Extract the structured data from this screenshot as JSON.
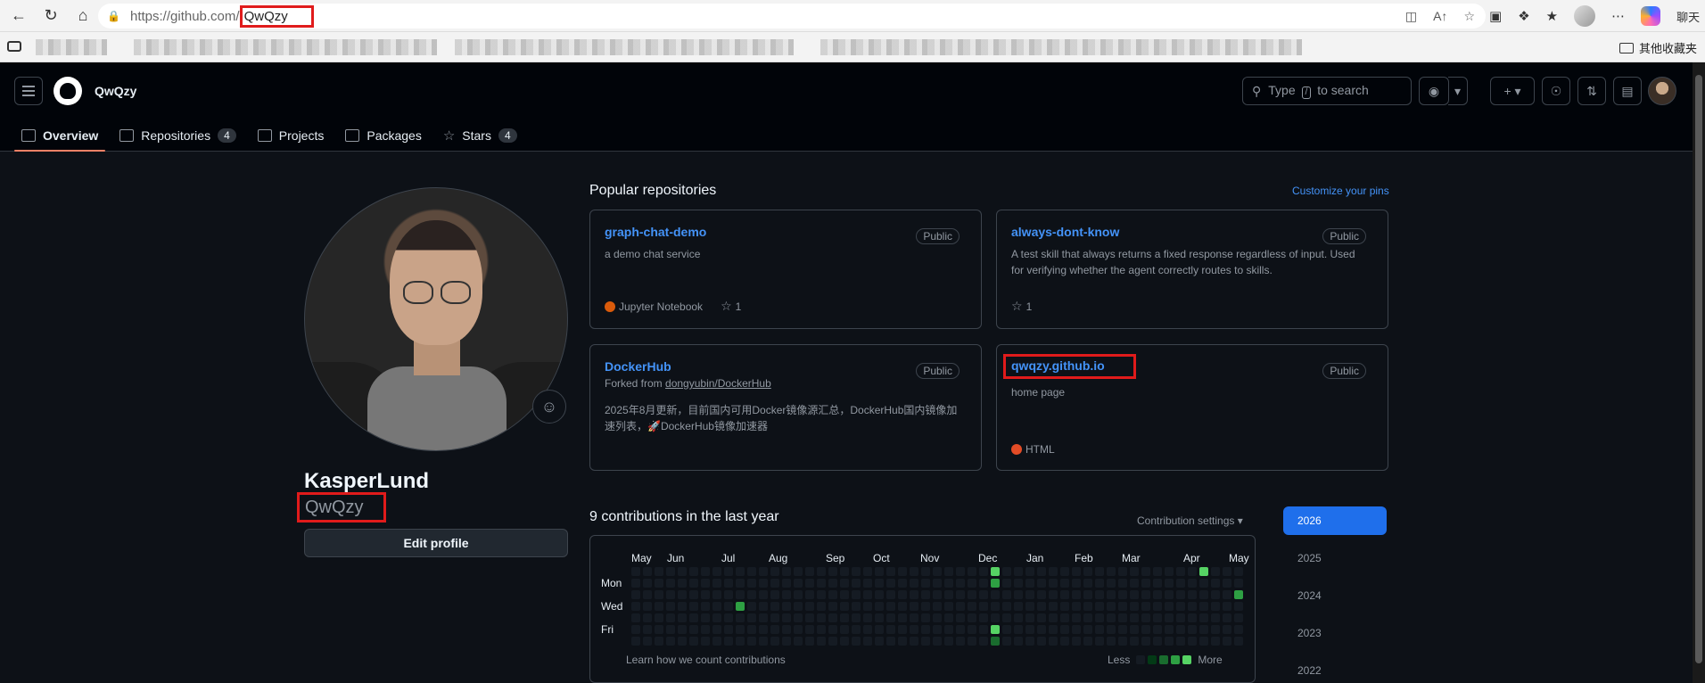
{
  "browser": {
    "url_host": "https://github.com/",
    "url_path": "QwQzy",
    "right_label": "聊天",
    "bookmark_folder": "其他收藏夹"
  },
  "header": {
    "username": "QwQzy",
    "search_placeholder_before": "Type",
    "search_key": "/",
    "search_placeholder_after": "to search"
  },
  "tabs": [
    {
      "label": "Overview",
      "icon": "book-icon"
    },
    {
      "label": "Repositories",
      "count": "4",
      "icon": "repo-icon"
    },
    {
      "label": "Projects",
      "icon": "table-icon"
    },
    {
      "label": "Packages",
      "icon": "package-icon"
    },
    {
      "label": "Stars",
      "count": "4",
      "icon": "star-icon"
    }
  ],
  "profile": {
    "full_name": "KasperLund",
    "login": "QwQzy",
    "edit_label": "Edit profile"
  },
  "popular": {
    "title": "Popular repositories",
    "customize": "Customize your pins",
    "repos": [
      {
        "name": "graph-chat-demo",
        "badge": "Public",
        "desc": "a demo chat service",
        "lang": "Jupyter Notebook",
        "lang_color": "#DA5B0B",
        "stars": "1"
      },
      {
        "name": "always-dont-know",
        "badge": "Public",
        "desc": "A test skill that always returns a fixed response regardless of input. Used for verifying whether the agent correctly routes to skills.",
        "stars": "1"
      },
      {
        "name": "DockerHub",
        "badge": "Public",
        "forked_prefix": "Forked from",
        "forked_from": "dongyubin/DockerHub",
        "desc": "2025年8月更新，目前国内可用Docker镜像源汇总，DockerHub国内镜像加速列表，🚀DockerHub镜像加速器"
      },
      {
        "name": "qwqzy.github.io",
        "badge": "Public",
        "desc": "home page",
        "lang": "HTML",
        "lang_color": "#e34c26"
      }
    ]
  },
  "contributions": {
    "title": "9 contributions in the last year",
    "settings": "Contribution settings",
    "months": [
      "May",
      "Jun",
      "Jul",
      "Aug",
      "Sep",
      "Oct",
      "Nov",
      "Dec",
      "Jan",
      "Feb",
      "Mar",
      "Apr",
      "May"
    ],
    "days": [
      "Mon",
      "Wed",
      "Fri"
    ],
    "learn": "Learn how we count contributions",
    "less": "Less",
    "more": "More",
    "colors": {
      "empty": "#151b23",
      "l1": "#033a16",
      "l2": "#196c2e",
      "l3": "#2ea043",
      "l4": "#56d364"
    },
    "active_cells": [
      {
        "week": 31,
        "day": 0,
        "level": "l4"
      },
      {
        "week": 31,
        "day": 1,
        "level": "l3"
      },
      {
        "week": 31,
        "day": 5,
        "level": "l4"
      },
      {
        "week": 9,
        "day": 3,
        "level": "l3"
      },
      {
        "week": 31,
        "day": 6,
        "level": "l2"
      },
      {
        "week": 49,
        "day": 0,
        "level": "l4"
      },
      {
        "week": 52,
        "day": 2,
        "level": "l3"
      }
    ],
    "years": [
      "2026",
      "2025",
      "2024",
      "2023",
      "2022"
    ]
  }
}
